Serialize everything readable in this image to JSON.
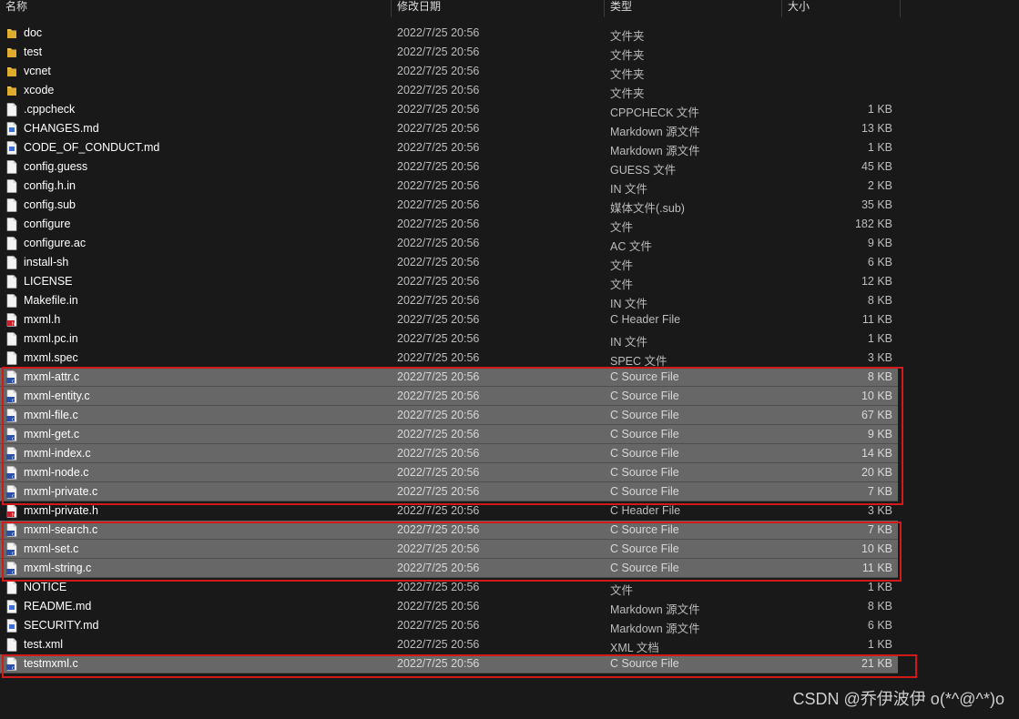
{
  "header": {
    "name": "名称",
    "date": "修改日期",
    "type": "类型",
    "size": "大小"
  },
  "files": [
    {
      "name": "doc",
      "date": "2022/7/25 20:56",
      "type": "文件夹",
      "size": "",
      "icon": "folder-icon",
      "selected": false
    },
    {
      "name": "test",
      "date": "2022/7/25 20:56",
      "type": "文件夹",
      "size": "",
      "icon": "folder-icon",
      "selected": false
    },
    {
      "name": "vcnet",
      "date": "2022/7/25 20:56",
      "type": "文件夹",
      "size": "",
      "icon": "folder-icon",
      "selected": false
    },
    {
      "name": "xcode",
      "date": "2022/7/25 20:56",
      "type": "文件夹",
      "size": "",
      "icon": "folder-icon",
      "selected": false
    },
    {
      "name": ".cppcheck",
      "date": "2022/7/25 20:56",
      "type": "CPPCHECK 文件",
      "size": "1 KB",
      "icon": "file-icon",
      "selected": false
    },
    {
      "name": "CHANGES.md",
      "date": "2022/7/25 20:56",
      "type": "Markdown 源文件",
      "size": "13 KB",
      "icon": "markdown-file-icon",
      "selected": false
    },
    {
      "name": "CODE_OF_CONDUCT.md",
      "date": "2022/7/25 20:56",
      "type": "Markdown 源文件",
      "size": "1 KB",
      "icon": "markdown-file-icon",
      "selected": false
    },
    {
      "name": "config.guess",
      "date": "2022/7/25 20:56",
      "type": "GUESS 文件",
      "size": "45 KB",
      "icon": "file-icon",
      "selected": false
    },
    {
      "name": "config.h.in",
      "date": "2022/7/25 20:56",
      "type": "IN 文件",
      "size": "2 KB",
      "icon": "file-icon",
      "selected": false
    },
    {
      "name": "config.sub",
      "date": "2022/7/25 20:56",
      "type": "媒体文件(.sub)",
      "size": "35 KB",
      "icon": "file-icon",
      "selected": false
    },
    {
      "name": "configure",
      "date": "2022/7/25 20:56",
      "type": "文件",
      "size": "182 KB",
      "icon": "file-icon",
      "selected": false
    },
    {
      "name": "configure.ac",
      "date": "2022/7/25 20:56",
      "type": "AC 文件",
      "size": "9 KB",
      "icon": "file-icon",
      "selected": false
    },
    {
      "name": "install-sh",
      "date": "2022/7/25 20:56",
      "type": "文件",
      "size": "6 KB",
      "icon": "file-icon",
      "selected": false
    },
    {
      "name": "LICENSE",
      "date": "2022/7/25 20:56",
      "type": "文件",
      "size": "12 KB",
      "icon": "file-icon",
      "selected": false
    },
    {
      "name": "Makefile.in",
      "date": "2022/7/25 20:56",
      "type": "IN 文件",
      "size": "8 KB",
      "icon": "file-icon",
      "selected": false
    },
    {
      "name": "mxml.h",
      "date": "2022/7/25 20:56",
      "type": "C Header File",
      "size": "11 KB",
      "icon": "c-header-file-icon",
      "selected": false
    },
    {
      "name": "mxml.pc.in",
      "date": "2022/7/25 20:56",
      "type": "IN 文件",
      "size": "1 KB",
      "icon": "file-icon",
      "selected": false
    },
    {
      "name": "mxml.spec",
      "date": "2022/7/25 20:56",
      "type": "SPEC 文件",
      "size": "3 KB",
      "icon": "file-icon",
      "selected": false
    },
    {
      "name": "mxml-attr.c",
      "date": "2022/7/25 20:56",
      "type": "C Source File",
      "size": "8 KB",
      "icon": "c-source-file-icon",
      "selected": true
    },
    {
      "name": "mxml-entity.c",
      "date": "2022/7/25 20:56",
      "type": "C Source File",
      "size": "10 KB",
      "icon": "c-source-file-icon",
      "selected": true
    },
    {
      "name": "mxml-file.c",
      "date": "2022/7/25 20:56",
      "type": "C Source File",
      "size": "67 KB",
      "icon": "c-source-file-icon",
      "selected": true
    },
    {
      "name": "mxml-get.c",
      "date": "2022/7/25 20:56",
      "type": "C Source File",
      "size": "9 KB",
      "icon": "c-source-file-icon",
      "selected": true
    },
    {
      "name": "mxml-index.c",
      "date": "2022/7/25 20:56",
      "type": "C Source File",
      "size": "14 KB",
      "icon": "c-source-file-icon",
      "selected": true
    },
    {
      "name": "mxml-node.c",
      "date": "2022/7/25 20:56",
      "type": "C Source File",
      "size": "20 KB",
      "icon": "c-source-file-icon",
      "selected": true
    },
    {
      "name": "mxml-private.c",
      "date": "2022/7/25 20:56",
      "type": "C Source File",
      "size": "7 KB",
      "icon": "c-source-file-icon",
      "selected": true
    },
    {
      "name": "mxml-private.h",
      "date": "2022/7/25 20:56",
      "type": "C Header File",
      "size": "3 KB",
      "icon": "c-header-file-icon",
      "selected": false
    },
    {
      "name": "mxml-search.c",
      "date": "2022/7/25 20:56",
      "type": "C Source File",
      "size": "7 KB",
      "icon": "c-source-file-icon",
      "selected": true
    },
    {
      "name": "mxml-set.c",
      "date": "2022/7/25 20:56",
      "type": "C Source File",
      "size": "10 KB",
      "icon": "c-source-file-icon",
      "selected": true
    },
    {
      "name": "mxml-string.c",
      "date": "2022/7/25 20:56",
      "type": "C Source File",
      "size": "11 KB",
      "icon": "c-source-file-icon",
      "selected": true
    },
    {
      "name": "NOTICE",
      "date": "2022/7/25 20:56",
      "type": "文件",
      "size": "1 KB",
      "icon": "file-icon",
      "selected": false
    },
    {
      "name": "README.md",
      "date": "2022/7/25 20:56",
      "type": "Markdown 源文件",
      "size": "8 KB",
      "icon": "markdown-file-icon",
      "selected": false
    },
    {
      "name": "SECURITY.md",
      "date": "2022/7/25 20:56",
      "type": "Markdown 源文件",
      "size": "6 KB",
      "icon": "markdown-file-icon",
      "selected": false
    },
    {
      "name": "test.xml",
      "date": "2022/7/25 20:56",
      "type": "XML 文档",
      "size": "1 KB",
      "icon": "file-icon",
      "selected": false
    },
    {
      "name": "testmxml.c",
      "date": "2022/7/25 20:56",
      "type": "C Source File",
      "size": "21 KB",
      "icon": "c-source-file-icon",
      "selected": true
    }
  ],
  "colors": {
    "background": "#191919",
    "selected_row": "#676767",
    "highlight_border": "#d11b1b",
    "folder": "#f0c24a",
    "c_source_badge": "#2b4ea8",
    "c_header_badge": "#c8202a"
  },
  "watermark": "CSDN @乔伊波伊 o(*^@^*)o"
}
